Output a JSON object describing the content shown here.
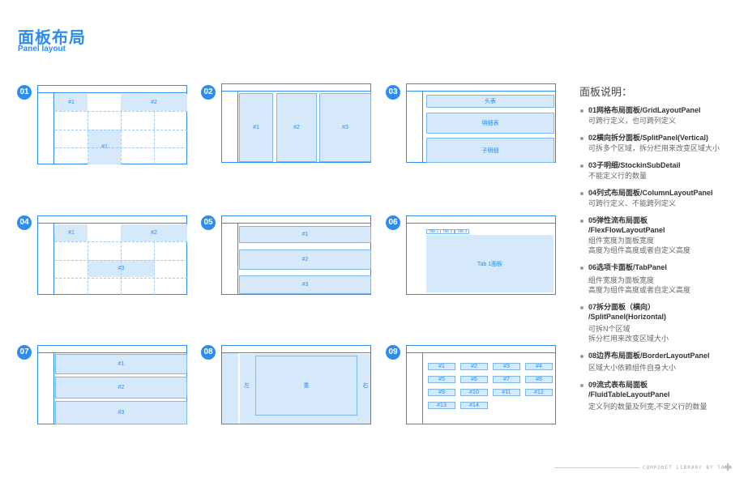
{
  "header": {
    "title": "面板布局",
    "subtitle": "Panel layout"
  },
  "badges": [
    "01",
    "02",
    "03",
    "04",
    "05",
    "06",
    "07",
    "08",
    "09"
  ],
  "panel1": {
    "c1": "#1",
    "c2": "#2",
    "c3": "#1"
  },
  "panel2": {
    "c1": "#1",
    "c2": "#2",
    "c3": "#3"
  },
  "panel3": {
    "c1": "头表",
    "c2": "明细表",
    "c3": "子明细"
  },
  "panel4": {
    "c1": "#1",
    "c2": "#2",
    "c3": "#3"
  },
  "panel5": {
    "c1": "#1",
    "c2": "#2",
    "c3": "#3"
  },
  "panel6": {
    "tabs": [
      "Tab 1",
      "Tab 2",
      "Tab 3"
    ],
    "content": "Tab 1面板"
  },
  "panel7": {
    "c1": "#1",
    "c2": "#2",
    "c3": "#3"
  },
  "panel8": {
    "left": "左",
    "center": "重",
    "right": "右"
  },
  "panel9": {
    "cells": [
      "#1",
      "#2",
      "#3",
      "#4",
      "#5",
      "#6",
      "#7",
      "#8",
      "#9",
      "#10",
      "#11",
      "#12",
      "#13",
      "#14"
    ]
  },
  "legend": {
    "title": "面板说明：",
    "items": [
      {
        "h": "01网格布局面板/GridLayoutPanel",
        "d": "可跨行定义，也可跨列定义"
      },
      {
        "h": "02横向拆分面板/SplitPanel(Vertical)",
        "d": "可拆多个区域，拆分栏用来改变区域大小"
      },
      {
        "h": "03子明细/StockinSubDetail",
        "d": "不能定义行的数量"
      },
      {
        "h": "04列式布局面板/ColumnLayoutPanel",
        "d": "可跨行定义、不能跨列定义"
      },
      {
        "h": "05弹性流布局面板",
        "h2": "/FlexFlowLayoutPanel",
        "d": "组件宽度为面板宽度",
        "d2": "高度为组件高度或者自定义高度"
      },
      {
        "h": "06选项卡面板/TabPanel",
        "d": "组件宽度为面板宽度",
        "d2": "高度为组件高度或者自定义高度"
      },
      {
        "h": "07拆分面板（横向）",
        "h2": "/SplitPanel(Horizontal)",
        "d": "可拆N个区域",
        "d2": "拆分栏用来改变区域大小"
      },
      {
        "h": "08边界布局面板/BorderLayoutPanel",
        "d": "区域大小依赖组件自身大小"
      },
      {
        "h": "09流式表布局面板",
        "h2": "/FluidTableLayoutPanel",
        "d": "定义列的数量及列宽,不定义行的数量"
      }
    ]
  },
  "footer": "COMPONET LIBRARY BY TANG"
}
